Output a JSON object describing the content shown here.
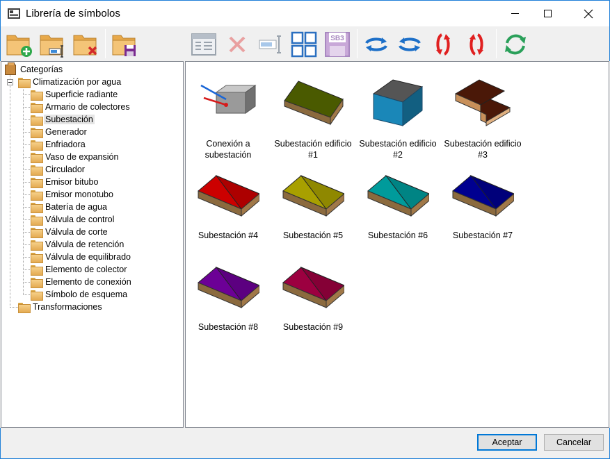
{
  "window": {
    "title": "Librería de símbolos"
  },
  "toolbar": {
    "buttons": [
      {
        "name": "new-category-icon"
      },
      {
        "name": "rename-category-icon"
      },
      {
        "name": "delete-category-icon"
      },
      {
        "name": "save-category-icon"
      },
      {
        "name": "edit-symbol-icon"
      },
      {
        "name": "delete-symbol-icon"
      },
      {
        "name": "rename-symbol-icon"
      },
      {
        "name": "grid-view-icon"
      },
      {
        "name": "sb3-icon",
        "text": "SB3"
      },
      {
        "name": "rotate-horizontal-icon"
      },
      {
        "name": "rotate-horizontal-reverse-icon"
      },
      {
        "name": "rotate-vertical-icon"
      },
      {
        "name": "rotate-vertical-reverse-icon"
      },
      {
        "name": "refresh-icon"
      }
    ]
  },
  "tree": {
    "root": "Categorías",
    "group": "Climatización por agua",
    "items": [
      "Superficie radiante",
      "Armario de colectores",
      "Subestación",
      "Generador",
      "Enfriadora",
      "Vaso de expansión",
      "Circulador",
      "Emisor bitubo",
      "Emisor monotubo",
      "Batería de agua",
      "Válvula de control",
      "Válvula de corte",
      "Válvula de retención",
      "Válvula de equilibrado",
      "Elemento de colector",
      "Elemento de conexión",
      "Símbolo de esquema"
    ],
    "selected": "Subestación",
    "other_group": "Transformaciones"
  },
  "symbols": [
    {
      "caption_1": "Conexión a",
      "caption_2": "subestación",
      "kind": "connection"
    },
    {
      "caption_1": "Subestación edificio",
      "caption_2": "#1",
      "kind": "gable",
      "color": "#4a5a00"
    },
    {
      "caption_1": "Subestación edificio",
      "caption_2": "#2",
      "kind": "block",
      "color": "#1a87b8"
    },
    {
      "caption_1": "Subestación edificio",
      "caption_2": "#3",
      "kind": "stepped",
      "color": "#4a1808"
    },
    {
      "caption_1": "Subestación #4",
      "caption_2": "",
      "kind": "hip",
      "color": "#cc0000"
    },
    {
      "caption_1": "Subestación #5",
      "caption_2": "",
      "kind": "hip",
      "color": "#a8a000"
    },
    {
      "caption_1": "Subestación #6",
      "caption_2": "",
      "kind": "hip",
      "color": "#009b9b"
    },
    {
      "caption_1": "Subestación #7",
      "caption_2": "",
      "kind": "hip",
      "color": "#000090"
    },
    {
      "caption_1": "Subestación #8",
      "caption_2": "",
      "kind": "hip",
      "color": "#6c0096"
    },
    {
      "caption_1": "Subestación #9",
      "caption_2": "",
      "kind": "hip",
      "color": "#9c0040"
    }
  ],
  "footer": {
    "accept": "Aceptar",
    "cancel": "Cancelar"
  }
}
